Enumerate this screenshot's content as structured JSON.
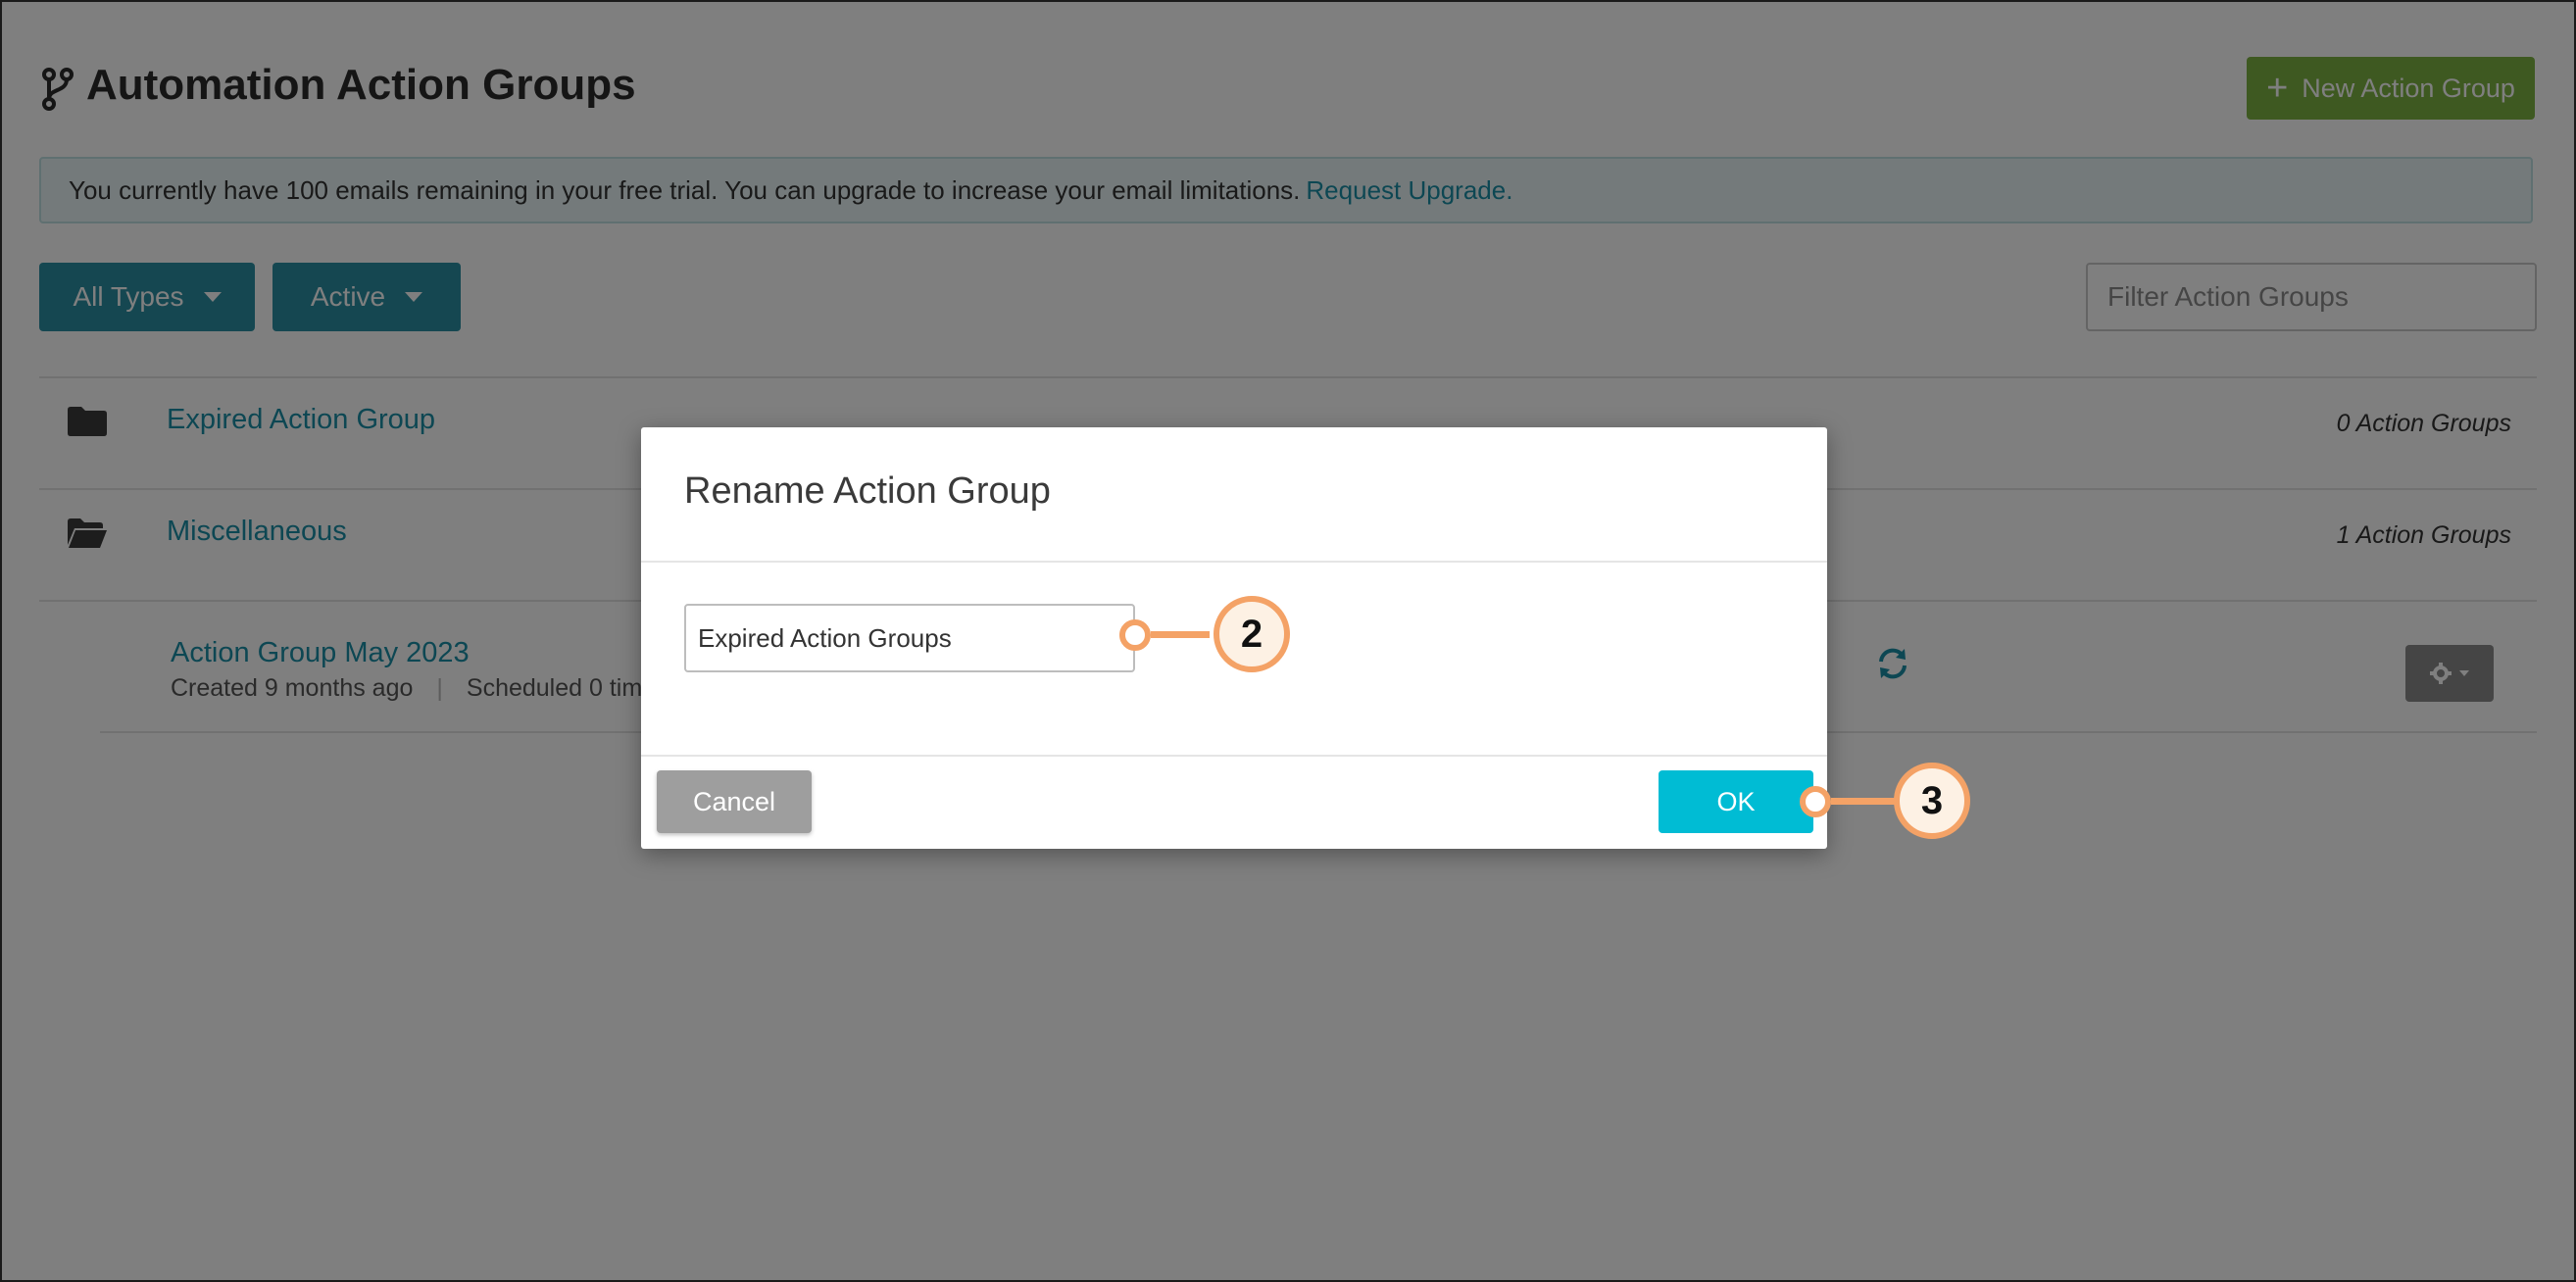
{
  "header": {
    "title": "Automation Action Groups",
    "title_icon": "branch-icon",
    "new_button_label": "New Action Group"
  },
  "banner": {
    "text": "You currently have 100 emails remaining in your free trial. You can upgrade to increase your email limitations.",
    "link_text": "Request Upgrade."
  },
  "filters": {
    "type_dropdown": "All Types",
    "status_dropdown": "Active",
    "search_placeholder": "Filter Action Groups"
  },
  "list": {
    "rows": [
      {
        "name": "Expired Action Group",
        "count": "0 Action Groups",
        "icon": "folder-icon"
      },
      {
        "name": "Miscellaneous",
        "count": "1 Action Groups",
        "icon": "folder-open-icon"
      }
    ],
    "subitem": {
      "name": "Action Group May 2023",
      "created": "Created 9 months ago",
      "scheduled": "Scheduled 0 tim"
    }
  },
  "modal": {
    "title": "Rename Action Group",
    "input_value": "Expired Action Groups",
    "cancel_label": "Cancel",
    "ok_label": "OK"
  },
  "callouts": {
    "input_step": "2",
    "ok_step": "3"
  },
  "colors": {
    "primary": "#2a8fa3",
    "new_button": "#7cb342",
    "ok_button": "#00bcd4",
    "callout": "#f4a266"
  }
}
